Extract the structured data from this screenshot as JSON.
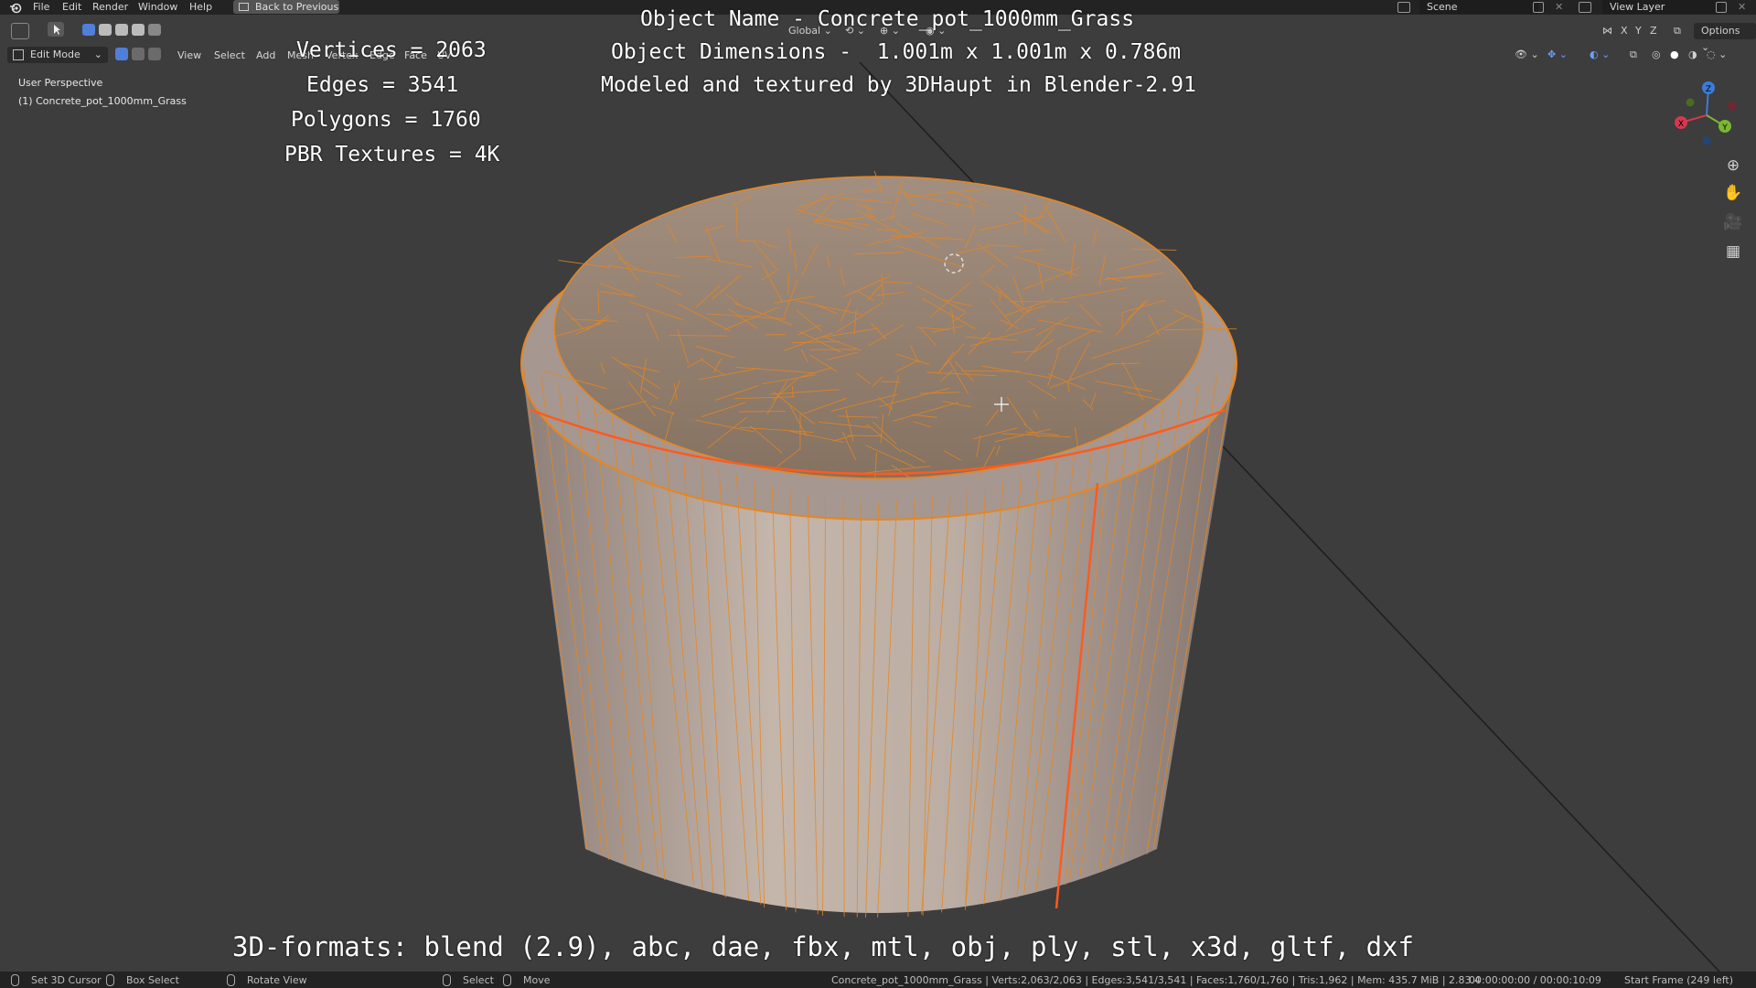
{
  "menu": {
    "file": "File",
    "edit": "Edit",
    "render": "Render",
    "window": "Window",
    "help": "Help"
  },
  "back_button": "Back to Previous",
  "scene": "Scene",
  "view_layer": "View Layer",
  "header": {
    "mode": "Edit Mode",
    "view": "View",
    "select": "Select",
    "add": "Add",
    "mesh": "Mesh",
    "vertex": "Vertex",
    "edge": "Edge",
    "face": "Face",
    "uv": "UV",
    "transform_orientation": "Global",
    "axis_x": "X",
    "axis_y": "Y",
    "axis_z": "Z",
    "options": "Options"
  },
  "viewport": {
    "perspective": "User Perspective",
    "object": "(1) Concrete_pot_1000mm_Grass"
  },
  "overlay": {
    "object_name": "Object Name - Concrete_pot_1000mm_Grass",
    "dimensions": "Object Dimensions -  1.001m x 1.001m x 0.786m",
    "credit": "Modeled and textured by 3DHaupt in Blender-2.91",
    "vertices": "Vertices = 2063",
    "edges": "Edges = 3541",
    "polygons": "Polygons = 1760",
    "textures": "PBR Textures = 4K",
    "formats": "3D-formats: blend (2.9), abc, dae, fbx, mtl, obj, ply, stl, x3d, gltf, dxf"
  },
  "gizmo": {
    "x": "X",
    "y": "Y",
    "z": "Z"
  },
  "status": {
    "set_cursor": "Set 3D Cursor",
    "box_select": "Box Select",
    "rotate_view": "Rotate View",
    "select": "Select",
    "move": "Move",
    "stats": "Concrete_pot_1000mm_Grass | Verts:2,063/2,063 | Edges:3,541/3,541 | Faces:1,760/1,760 | Tris:1,962 | Mem: 435.7 MiB | 2.83.4",
    "time": "00:00:00:00 / 00:00:10:09",
    "frame": "Start Frame (249 left)"
  },
  "colors": {
    "bg": "#3d3d3d",
    "mesh_edge": "#e8861f",
    "active_edge": "#ff5a1f",
    "surface": "#b5a69c"
  }
}
